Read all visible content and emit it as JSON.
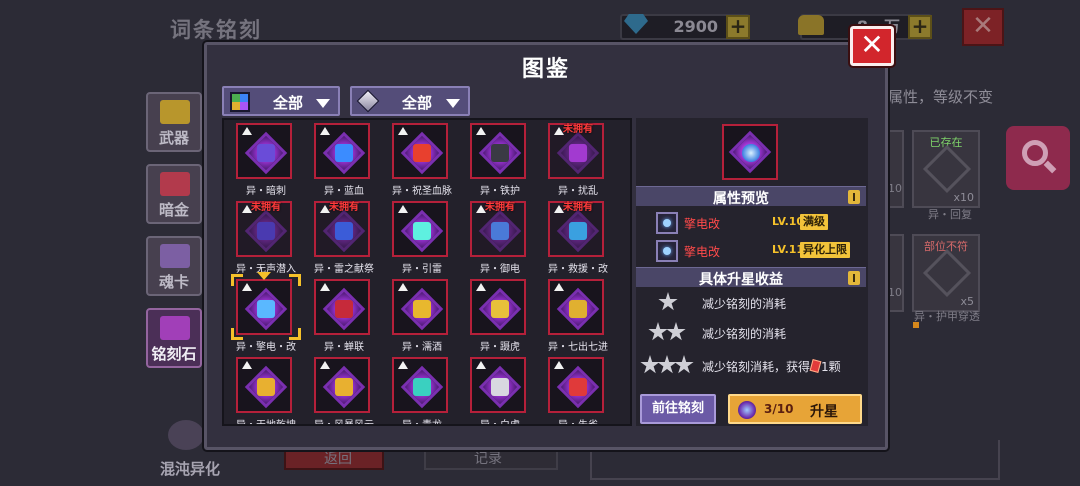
{
  "background": {
    "title": "词条铭刻",
    "currency": [
      {
        "icon": "blue-gem-icon",
        "value": "2900"
      },
      {
        "icon": "gold-chest-icon",
        "value": "8…万"
      }
    ],
    "sidebar": [
      {
        "label": "武器",
        "icon": "weapon-icon",
        "color": "#b8962c"
      },
      {
        "label": "暗金",
        "icon": "dark-gold-icon",
        "color": "#b23a4c"
      },
      {
        "label": "魂卡",
        "icon": "soul-card-icon",
        "color": "#7c5fa3"
      },
      {
        "label": "铭刻石",
        "icon": "inscription-stone-icon",
        "color": "#a13fb8"
      }
    ],
    "chaos_label": "混沌异化",
    "hint": "属性，等级不变",
    "cards": [
      {
        "tag": "已存在",
        "tag_color": "#7fd46a",
        "count": "x10",
        "label": "异・回复"
      },
      {
        "tag": "部位不符",
        "tag_color": "#d76a6a",
        "count": "x5",
        "label": "异・护甲穿透"
      }
    ],
    "partial_counts": [
      "10",
      "10"
    ],
    "bottom_buttons": [
      "返回",
      "记录"
    ]
  },
  "modal": {
    "title": "图鉴",
    "filters": [
      {
        "label": "全部",
        "icon": "color-grid-icon"
      },
      {
        "label": "全部",
        "icon": "diamond-icon"
      }
    ],
    "items": [
      {
        "label": "异・暗刺",
        "unowned": false,
        "emblem": "#6a4cd8"
      },
      {
        "label": "异・蓝血",
        "unowned": false,
        "emblem": "#3b8cff"
      },
      {
        "label": "异・祝圣血脉",
        "unowned": false,
        "emblem": "#e8402e"
      },
      {
        "label": "异・铁护",
        "unowned": false,
        "emblem": "#3a3a44"
      },
      {
        "label": "异・扰乱",
        "unowned": true,
        "emblem": "#a23ad0"
      },
      {
        "label": "异・无声潜入",
        "unowned": true,
        "emblem": "#4a3ab0"
      },
      {
        "label": "异・雷之献祭",
        "unowned": true,
        "emblem": "#3b5cd8"
      },
      {
        "label": "异・引雷",
        "unowned": false,
        "emblem": "#5ef0e0"
      },
      {
        "label": "异・御电",
        "unowned": true,
        "emblem": "#4a7ad8"
      },
      {
        "label": "异・救援・改",
        "unowned": true,
        "emblem": "#3aa0e0"
      },
      {
        "label": "异・擎电・改",
        "unowned": false,
        "emblem": "#5ab8ff",
        "selected": true
      },
      {
        "label": "异・蝉联",
        "unowned": false,
        "emblem": "#c62a3a"
      },
      {
        "label": "异・濡酒",
        "unowned": false,
        "emblem": "#e8b82e"
      },
      {
        "label": "异・蹑虎",
        "unowned": false,
        "emblem": "#e8c03a"
      },
      {
        "label": "异・七出七进",
        "unowned": false,
        "emblem": "#e0b030"
      },
      {
        "label": "异・天地乾坤",
        "unowned": false,
        "emblem": "#e8b030"
      },
      {
        "label": "异・风暴风云",
        "unowned": false,
        "emblem": "#e8b030"
      },
      {
        "label": "异・青龙",
        "unowned": false,
        "emblem": "#3ad0c0"
      },
      {
        "label": "异・白虎",
        "unowned": false,
        "emblem": "#d8d8e0"
      },
      {
        "label": "异・朱雀",
        "unowned": false,
        "emblem": "#e03a3a"
      }
    ],
    "unowned_label": "未拥有",
    "detail": {
      "preview_title": "属性预览",
      "attrs": [
        {
          "name": "擎电改",
          "level": "LV.10",
          "badge": "满级"
        },
        {
          "name": "擎电改",
          "level": "LV.11",
          "badge": "异化上限"
        }
      ],
      "upgrade_title": "具体升星收益",
      "stars": [
        {
          "count": 1,
          "text": "减少铭刻的消耗"
        },
        {
          "count": 2,
          "text": "减少铭刻的消耗"
        },
        {
          "count": 3,
          "text_before": "减少铭刻消耗，获得",
          "text_after": "1颗"
        }
      ],
      "goto_label": "前往铭刻",
      "upgrade_progress": "3/10",
      "upgrade_label": "升星"
    }
  }
}
